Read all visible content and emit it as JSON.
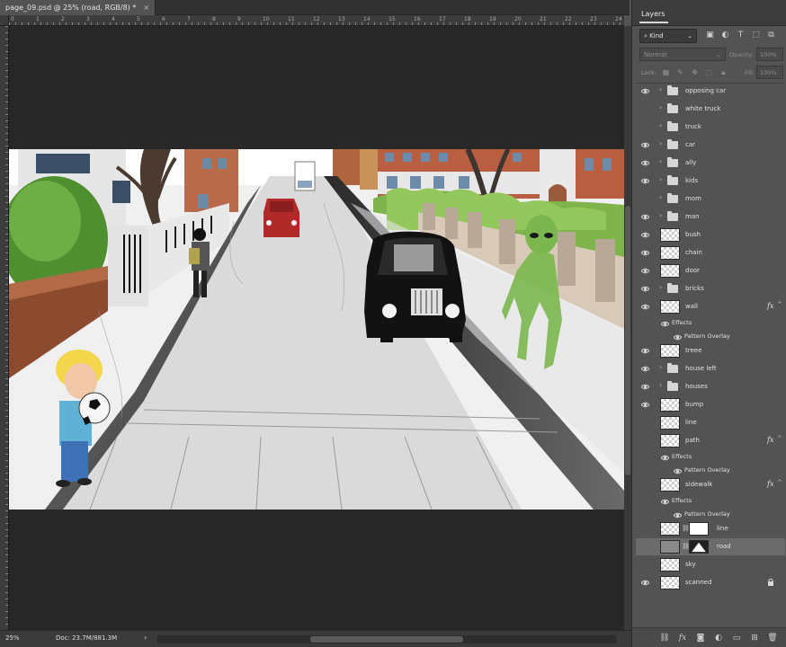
{
  "document": {
    "tab_title": "page_09.psd @ 25% (road, RGB/8) *",
    "close_glyph": "×",
    "ruler_labels": [
      "0",
      "1",
      "2",
      "3",
      "4",
      "5",
      "6",
      "7",
      "8",
      "9",
      "10",
      "11",
      "12",
      "13",
      "14",
      "15",
      "16",
      "17",
      "18",
      "19",
      "20",
      "21",
      "22",
      "23",
      "24"
    ]
  },
  "status": {
    "zoom": "25%",
    "doc_info": "Doc: 23.7M/881.3M",
    "arrow": "›",
    "scroll_left": "‹",
    "scroll_right": "›"
  },
  "panel": {
    "title": "Layers",
    "filter_kind": "Kind",
    "blend_mode": "Normal",
    "opacity_label": "Opacity:",
    "opacity_value": "100%",
    "lock_label": "Lock:",
    "fill_label": "Fill:",
    "fill_value": "100%"
  },
  "layers": [
    {
      "name": "opposing car",
      "type": "group",
      "visible": true
    },
    {
      "name": "white truck",
      "type": "group",
      "visible": false
    },
    {
      "name": "truck",
      "type": "group",
      "visible": false
    },
    {
      "name": "car",
      "type": "group",
      "visible": true
    },
    {
      "name": "ally",
      "type": "group",
      "visible": true
    },
    {
      "name": "kids",
      "type": "group",
      "visible": true
    },
    {
      "name": "mom",
      "type": "group",
      "visible": false
    },
    {
      "name": "man",
      "type": "group",
      "visible": true
    },
    {
      "name": "bush",
      "type": "pixel",
      "visible": true
    },
    {
      "name": "chain",
      "type": "pixel",
      "visible": true
    },
    {
      "name": "door",
      "type": "pixel",
      "visible": true
    },
    {
      "name": "bricks",
      "type": "group",
      "visible": true
    },
    {
      "name": "wall",
      "type": "pixel",
      "visible": true,
      "fx": true
    },
    {
      "name": "treee",
      "type": "pixel",
      "visible": true
    },
    {
      "name": "house left",
      "type": "group",
      "visible": true
    },
    {
      "name": "houses",
      "type": "group",
      "visible": true
    },
    {
      "name": "bump",
      "type": "pixel",
      "visible": true
    },
    {
      "name": "line",
      "type": "pixel",
      "visible": false
    },
    {
      "name": "path",
      "type": "pixel",
      "visible": false,
      "fx": true
    },
    {
      "name": "sidewalk",
      "type": "pixel",
      "visible": false,
      "fx": true
    },
    {
      "name": "line",
      "type": "masked",
      "visible": false
    },
    {
      "name": "road",
      "type": "masked",
      "visible": false,
      "selected": true
    },
    {
      "name": "sky",
      "type": "pixel",
      "visible": false
    },
    {
      "name": "scanned",
      "type": "pixel",
      "visible": true,
      "locked": true
    }
  ],
  "effects": {
    "effects_label": "Effects",
    "pattern_overlay_label": "Pattern Overlay",
    "fx_glyph": "fx",
    "fx_chevron": "^"
  },
  "colors": {
    "panel_bg": "#535353",
    "pasteboard": "#282828",
    "selected_row": "#6b6b6b"
  }
}
